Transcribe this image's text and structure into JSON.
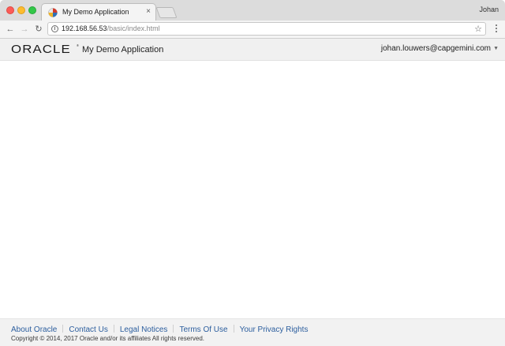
{
  "browser": {
    "tab": {
      "title": "My Demo Application",
      "close_glyph": "×",
      "favicon": "oracle-app-favicon"
    },
    "profile_name": "Johan",
    "toolbar": {
      "back_glyph": "←",
      "forward_glyph": "→",
      "reload_glyph": "↻",
      "info_glyph": "i",
      "star_glyph": "☆"
    },
    "url": {
      "host": "192.168.56.53",
      "path": "/basic/index.html"
    }
  },
  "app": {
    "logo_text": "ORACLE",
    "logo_reg": "®",
    "title": "My Demo Application",
    "user": "johan.louwers@capgemini.com",
    "user_caret": "▼"
  },
  "footer": {
    "links": [
      {
        "label": "About Oracle"
      },
      {
        "label": "Contact Us"
      },
      {
        "label": "Legal Notices"
      },
      {
        "label": "Terms Of Use"
      },
      {
        "label": "Your Privacy Rights"
      }
    ],
    "copyright": "Copyright © 2014, 2017 Oracle and/or its affiliates All rights reserved."
  },
  "colors": {
    "link": "#2c5e9e",
    "header_bg": "#f0f0f0",
    "footer_bg": "#f2f2f2"
  }
}
